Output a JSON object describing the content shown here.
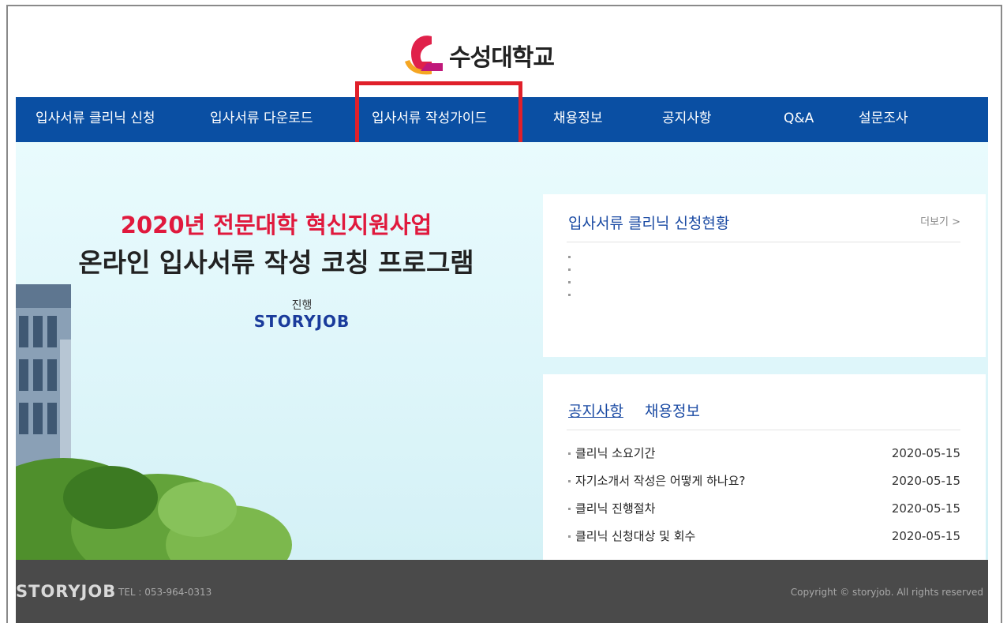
{
  "header": {
    "logo_text": "수성대학교"
  },
  "nav": {
    "items": [
      {
        "label": "입사서류 클리닉 신청"
      },
      {
        "label": "입사서류 다운로드"
      },
      {
        "label": "입사서류 작성가이드"
      },
      {
        "label": "채용정보"
      },
      {
        "label": "공지사항"
      },
      {
        "label": "Q&A"
      },
      {
        "label": "설문조사"
      }
    ],
    "highlighted_item": "입사서류 작성가이드"
  },
  "hero": {
    "title_line1": "2020년 전문대학 혁신지원사업",
    "title_line2": "온라인 입사서류 작성 코칭 프로그램",
    "by_label": "진행",
    "brand": "STORYJOB"
  },
  "clinic_panel": {
    "title": "입사서류 클리닉 신청현황",
    "more_label": "더보기 >"
  },
  "notice_panel": {
    "tabs": [
      "공지사항",
      "채용정보"
    ],
    "active_tab": "공지사항",
    "items": [
      {
        "title": "클리닉 소요기간",
        "date": "2020-05-15"
      },
      {
        "title": "자기소개서 작성은 어떻게 하나요?",
        "date": "2020-05-15"
      },
      {
        "title": "클리닉 진행절차",
        "date": "2020-05-15"
      },
      {
        "title": "클리닉 신청대상 및 회수",
        "date": "2020-05-15"
      }
    ]
  },
  "footer": {
    "brand": "STORYJOB",
    "tel": "TEL : 053-964-0313",
    "copyright": "Copyright © storyjob. All rights reserved"
  },
  "colors": {
    "nav_bg": "#0a4fa3",
    "highlight": "#e0202a",
    "title_red": "#e0193d",
    "link_blue": "#1a4aa3"
  }
}
